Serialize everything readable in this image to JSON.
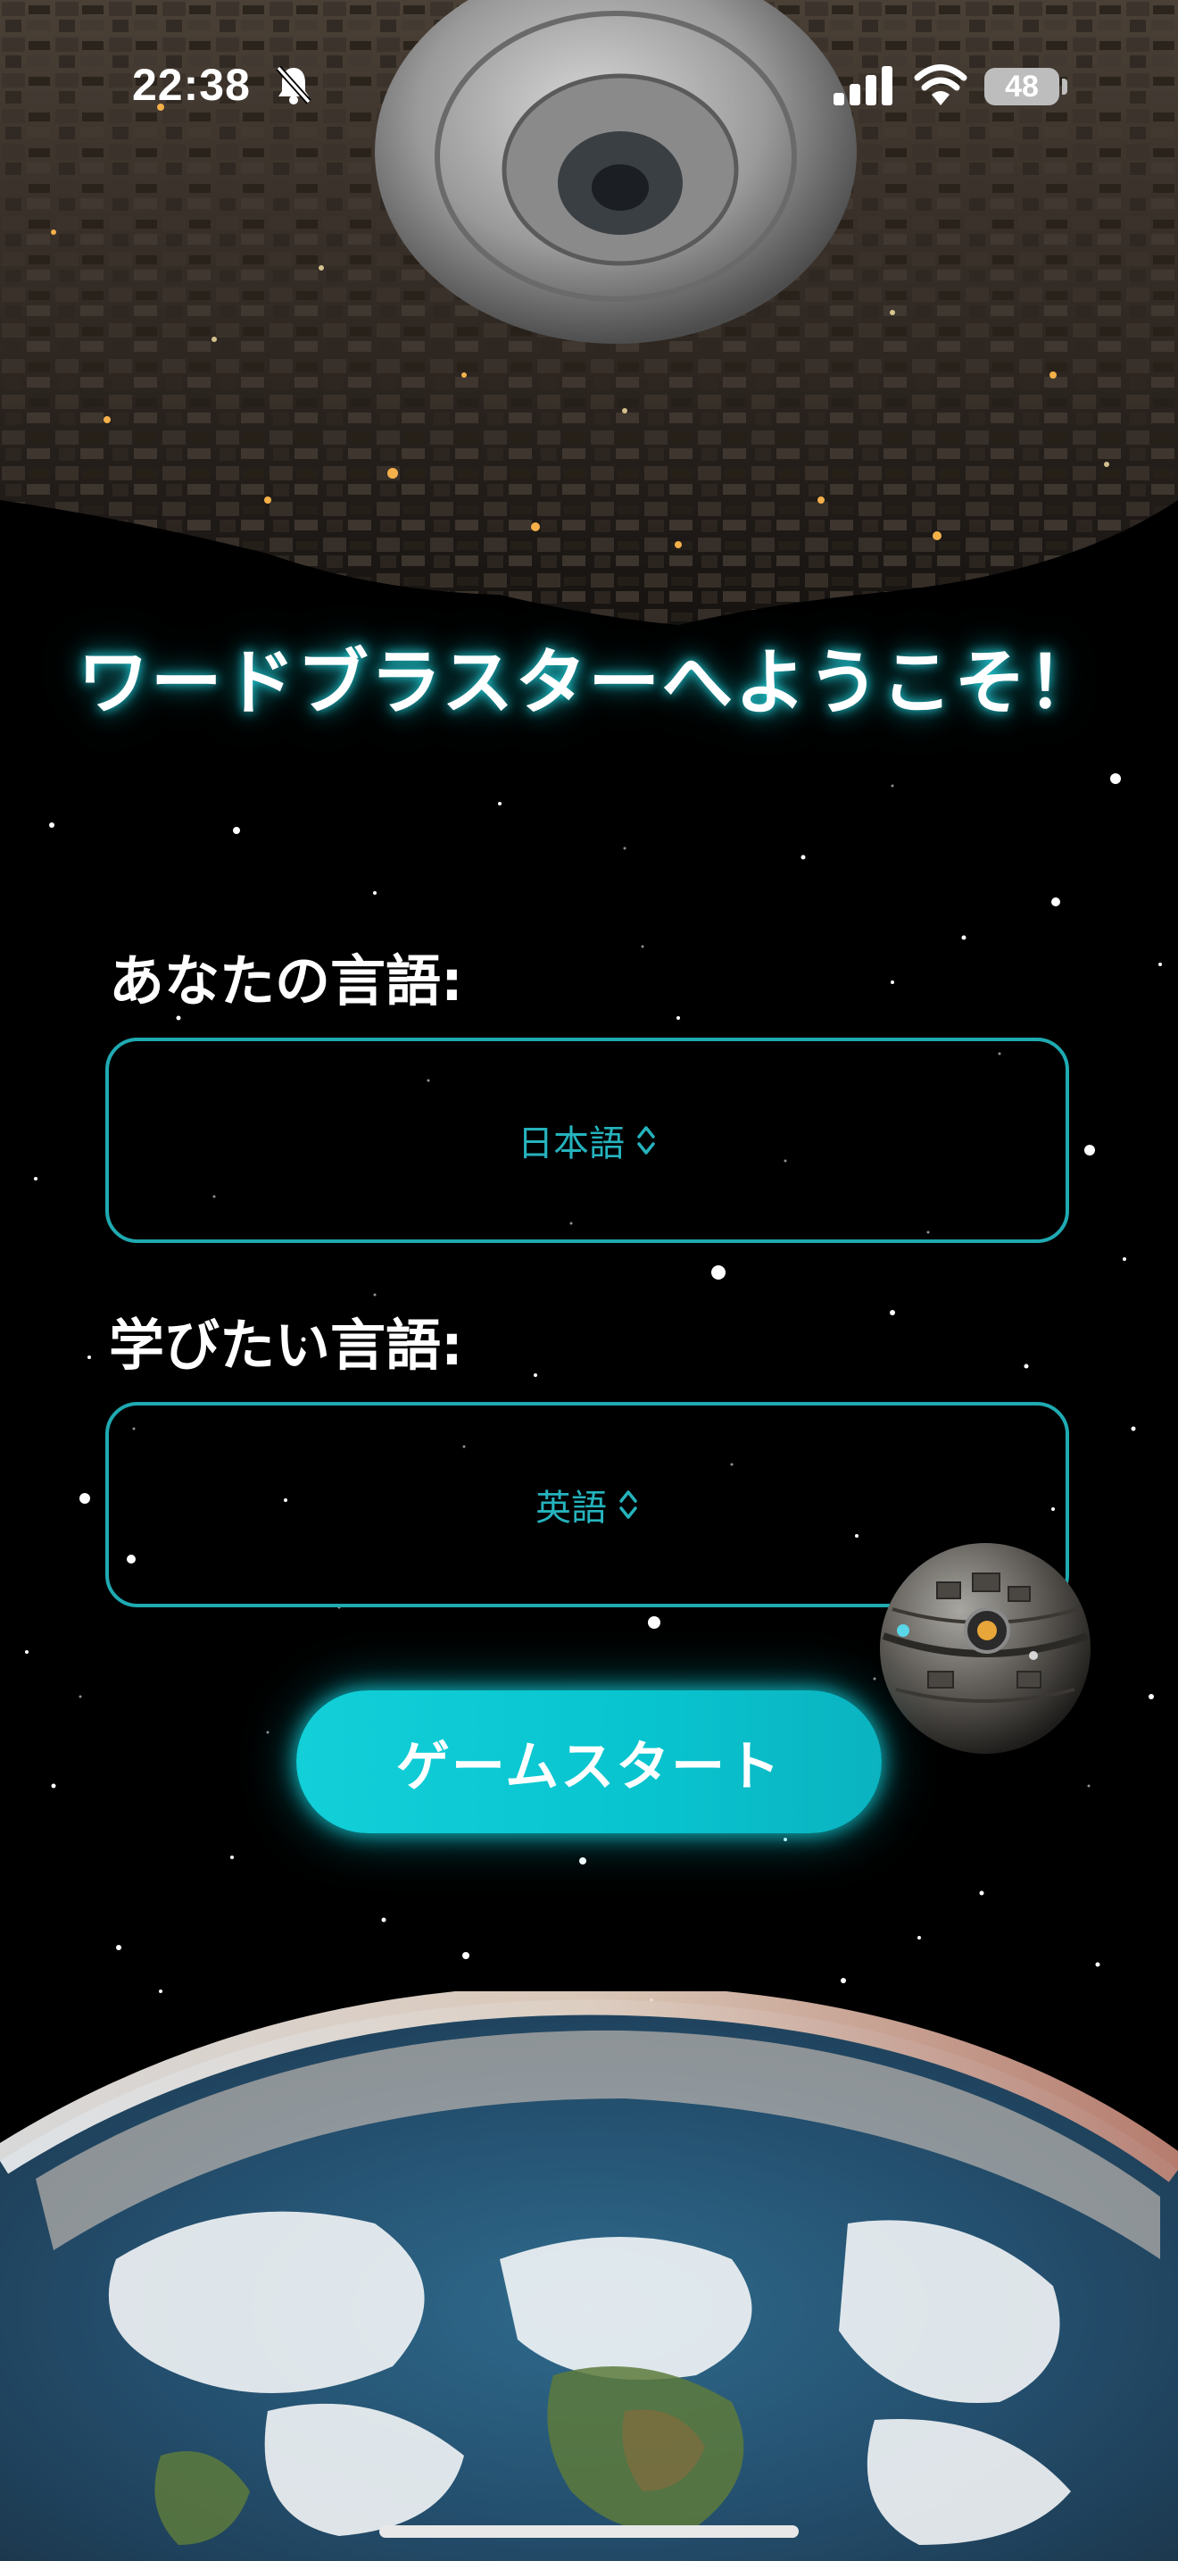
{
  "status_bar": {
    "time": "22:38",
    "battery": "48",
    "icons": [
      "bell-slash-icon",
      "cellular-signal-icon",
      "wifi-icon",
      "battery-icon"
    ]
  },
  "welcome": {
    "title": "ワードブラスターへようこそ！"
  },
  "form": {
    "native_language": {
      "label": "あなたの言語:",
      "selected": "日本語"
    },
    "target_language": {
      "label": "学びたい言語:",
      "selected": "英語"
    }
  },
  "start_button": {
    "label": "ゲームスタート"
  },
  "scene": {
    "illustrations": [
      "space-station",
      "small-planet",
      "earth"
    ]
  },
  "colors": {
    "accent": "#1FAAB2",
    "button": "#0EC8D2",
    "title_glow": "#22D6E0",
    "background": "#000000"
  }
}
